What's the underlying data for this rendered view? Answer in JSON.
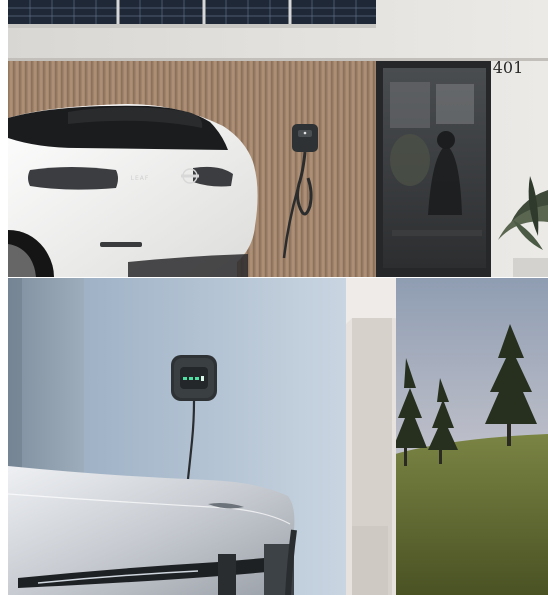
{
  "photos": [
    {
      "id": "top",
      "car_badge": "LEAF",
      "house_number": "401"
    },
    {
      "id": "bottom"
    }
  ],
  "colors": {
    "stucco": "#e3e1de",
    "wood": "#a8886d",
    "door_frame": "#27292a",
    "car_white": "#f4f4f2",
    "charger_dark": "#2e3234",
    "charger_led": "#4ee0a3",
    "wall_blue": "#aebfd0",
    "sky": "#b6bfcc",
    "grass": "#6e7a39"
  },
  "icons": [
    "nissan-logo-icon",
    "charger-led-icon"
  ]
}
